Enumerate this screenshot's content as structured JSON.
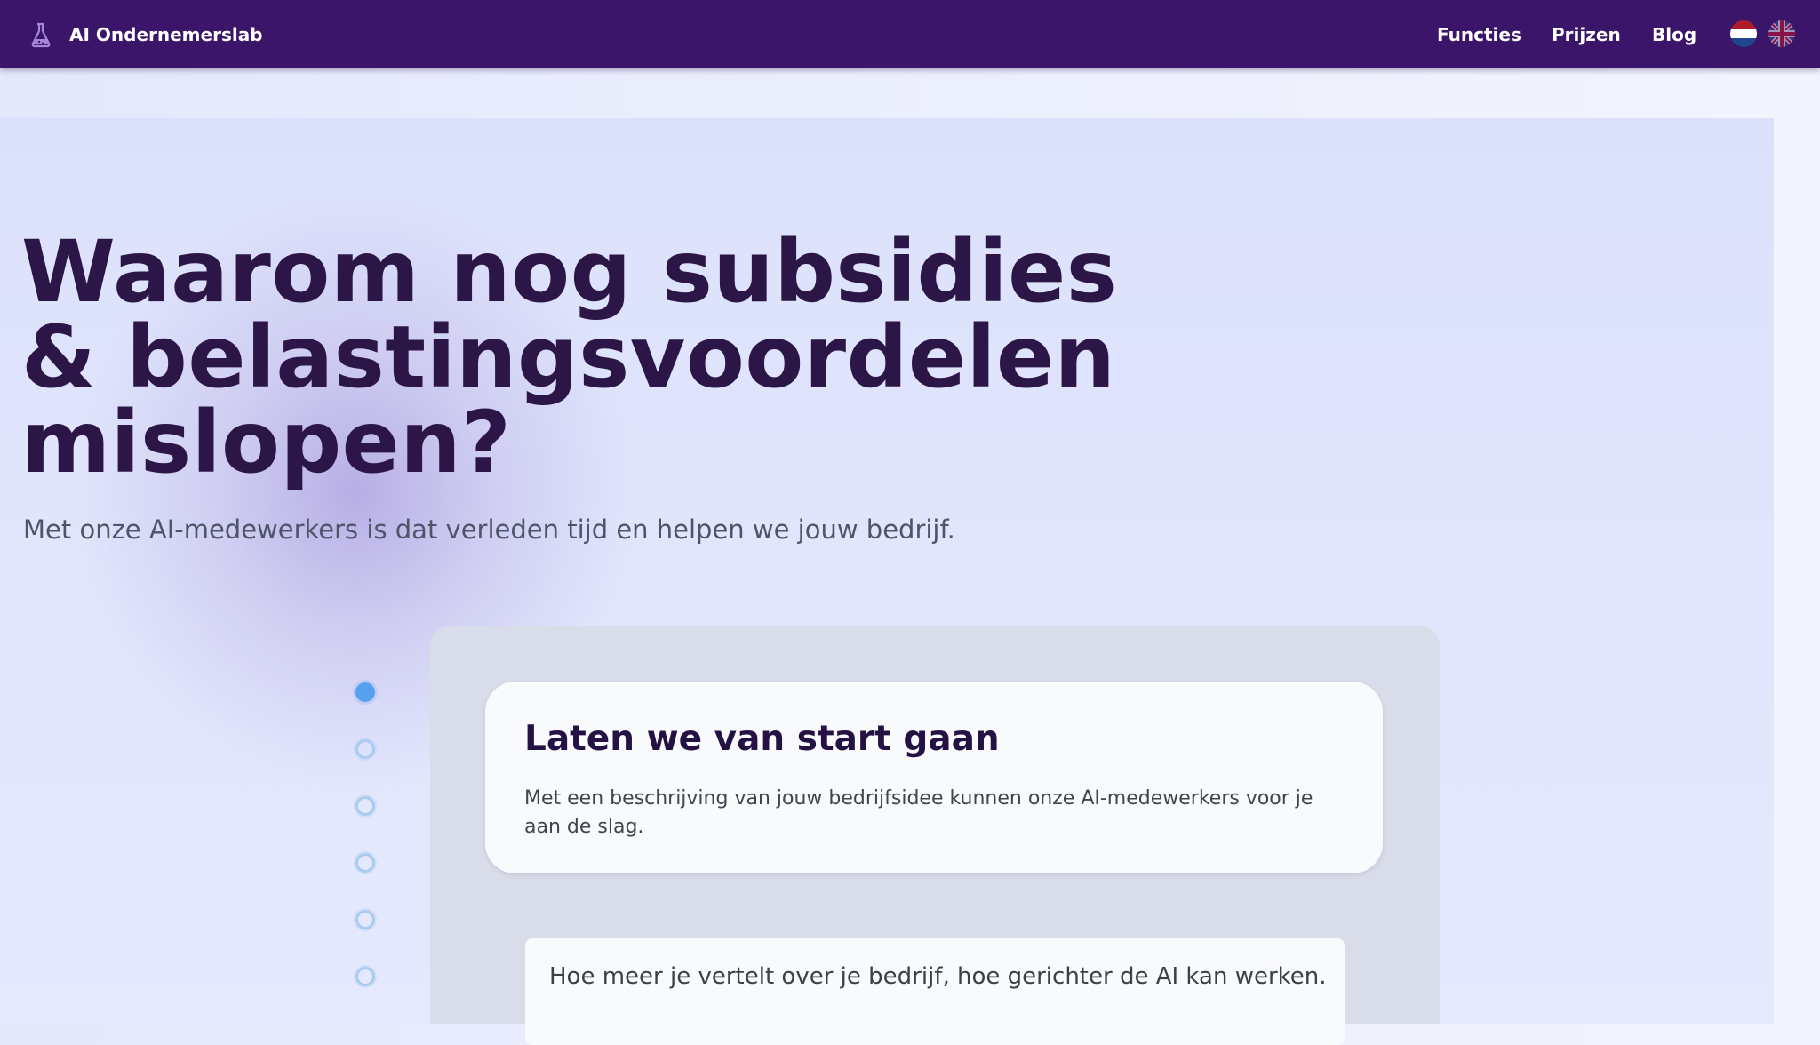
{
  "header": {
    "brand": "AI Ondernemerslab",
    "brand_icon": "flask-icon",
    "nav": [
      "Functies",
      "Prijzen",
      "Blog"
    ],
    "languages": [
      "nl-flag-icon",
      "uk-flag-icon"
    ],
    "colors": {
      "background": "#3b1569",
      "text": "#ffffff"
    }
  },
  "hero": {
    "headline_lines": [
      "Waarom nog subsidies",
      "& belastingsvoordelen",
      "mislopen?"
    ],
    "subline": "Met onze AI-medewerkers is dat verleden tijd en helpen we jouw bedrijf.",
    "colors": {
      "headline": "#2c1647",
      "subline": "#4e5568"
    }
  },
  "wizard": {
    "total_steps": 6,
    "active_step": 1,
    "card": {
      "title": "Laten we van start gaan",
      "description": "Met een beschrijving van jouw bedrijfsidee kunnen onze AI-medewerkers voor je aan de slag."
    },
    "input_hint": "Hoe meer je vertelt over je bedrijf, hoe gerichter de AI kan werken.",
    "colors": {
      "active_step": "#57a0f0",
      "idle_step": "#a9cbf0"
    }
  }
}
